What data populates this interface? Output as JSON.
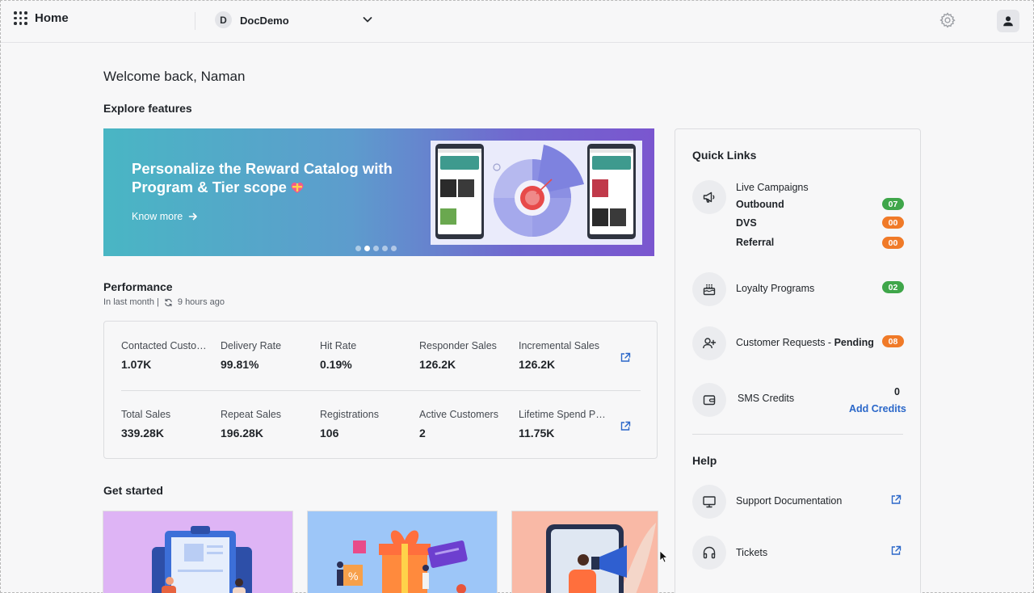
{
  "header": {
    "title": "Home",
    "org_initial": "D",
    "org_name": "DocDemo"
  },
  "welcome": "Welcome back, Naman",
  "explore": {
    "title": "Explore features",
    "banner": {
      "headline": "Personalize the Reward Catalog with Program & Tier scope",
      "link": "Know more",
      "slides": 5,
      "active_slide": 2
    }
  },
  "performance": {
    "title": "Performance",
    "period": "In last month |",
    "updated": "9 hours ago",
    "rows": [
      [
        {
          "label": "Contacted Customers",
          "value": "1.07K"
        },
        {
          "label": "Delivery Rate",
          "value": "99.81%"
        },
        {
          "label": "Hit Rate",
          "value": "0.19%"
        },
        {
          "label": "Responder Sales",
          "value": "126.2K"
        },
        {
          "label": "Incremental Sales",
          "value": "126.2K"
        }
      ],
      [
        {
          "label": "Total Sales",
          "value": "339.28K"
        },
        {
          "label": "Repeat Sales",
          "value": "196.28K"
        },
        {
          "label": "Registrations",
          "value": "106"
        },
        {
          "label": "Active Customers",
          "value": "2"
        },
        {
          "label": "Lifetime Spend Per Customer",
          "value": "11.75K"
        }
      ]
    ]
  },
  "get_started": {
    "title": "Get started",
    "card_colors": [
      "#deb4f5",
      "#9dc6f8",
      "#f9b9a6"
    ]
  },
  "quick_links": {
    "title": "Quick Links",
    "live_campaigns": {
      "label": "Live Campaigns",
      "items": [
        {
          "label": "Outbound",
          "count": "07",
          "status": "green"
        },
        {
          "label": "DVS",
          "count": "00",
          "status": "orange"
        },
        {
          "label": "Referral",
          "count": "00",
          "status": "orange"
        }
      ]
    },
    "loyalty": {
      "label": "Loyalty Programs",
      "count": "02"
    },
    "customer_requests": {
      "label": "Customer Requests - ",
      "status": "Pending",
      "count": "08"
    },
    "sms": {
      "label": "SMS Credits",
      "count": "0",
      "action": "Add Credits"
    }
  },
  "help": {
    "title": "Help",
    "items": [
      {
        "label": "Support Documentation"
      },
      {
        "label": "Tickets"
      }
    ]
  },
  "colors": {
    "accent_blue": "#2a67c9",
    "badge_green": "#3fa64a",
    "badge_orange": "#f07a28"
  }
}
